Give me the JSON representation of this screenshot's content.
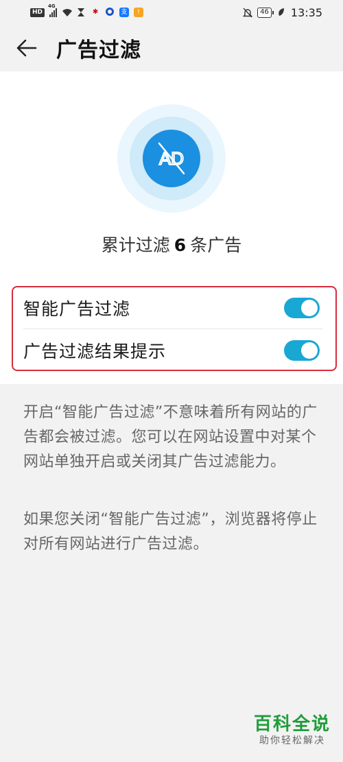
{
  "status_bar": {
    "hd": "HD",
    "network": "4G",
    "battery": "46",
    "time": "13:35"
  },
  "header": {
    "title": "广告过滤",
    "back_icon": "arrow-left-icon"
  },
  "hero": {
    "icon": "ad-blocked-icon",
    "icon_text": "AD",
    "counter_prefix": "累计过滤",
    "counter_value": "6",
    "counter_suffix": "条广告"
  },
  "settings": [
    {
      "label": "智能广告过滤",
      "enabled": true
    },
    {
      "label": "广告过滤结果提示",
      "enabled": true
    }
  ],
  "description": {
    "p1": "开启“智能广告过滤”不意味着所有网站的广告都会被过滤。您可以在网站设置中对某个网站单独开启或关闭其广告过滤能力。",
    "p2": "如果您关闭“智能广告过滤”，浏览器将停止对所有网站进行广告过滤。"
  },
  "watermark": {
    "main": "百科全说",
    "sub": "助你轻松解决"
  },
  "colors": {
    "accent": "#19a7d4",
    "icon_blue": "#1b8fe0",
    "highlight_border": "#d52b3b",
    "logo_green": "#1f9d3a"
  }
}
